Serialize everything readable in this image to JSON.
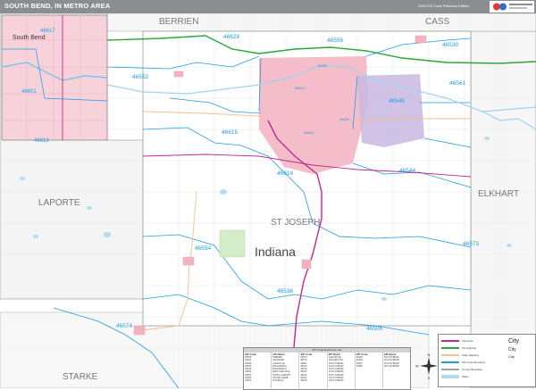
{
  "header": {
    "title": "SOUTH BEND, IN METRO AREA",
    "subtitle": "2020 ZIP Code Premium Edition"
  },
  "colors": {
    "water": "#b3dcf0",
    "zip_line": "#1e9be6",
    "highway": "#2aa63a",
    "interstate": "#c02a8a",
    "city_pink": "#f3b2c0",
    "city_purple": "#c9b8e2",
    "county_line": "#a0a0a0",
    "road": "#f2c28a"
  },
  "counties": {
    "berrien": "BERRIEN",
    "cass": "CASS",
    "laporte": "LAPORTE",
    "st_joseph": "ST JOSEPH",
    "elkhart": "ELKHART",
    "starke": "STARKE"
  },
  "state_label": "Indiana",
  "inset": {
    "city_label": "South Bend",
    "zips": [
      "46617",
      "46601",
      "46613"
    ]
  },
  "zips": {
    "z46552": "46552",
    "z46556": "46556",
    "z46530": "46530",
    "z46561": "46561",
    "z46545": "46545",
    "z46615": "46615",
    "z46614": "46614",
    "z46544": "46544",
    "z46554": "46554",
    "z46573": "46573",
    "z46536": "46536",
    "z46574": "46574",
    "z46506": "46506",
    "z46628": "46628",
    "z46616": "46616",
    "z46632": "46632",
    "z46680": "46680",
    "z46603": "46603"
  },
  "table": {
    "header": "ZIP Code Reference List",
    "columns": [
      {
        "h": "ZIP Code",
        "rows": [
          "46506",
          "46530",
          "46536",
          "46544",
          "46545",
          "46552",
          "46554",
          "46556",
          "46561"
        ]
      },
      {
        "h": "ZIP Name",
        "rows": [
          "BREMEN",
          "GRANGER",
          "LAKEVILLE",
          "MISHAWAKA",
          "MISHAWAKA",
          "NEW CARLISLE",
          "NORTH LIBERTY",
          "NOTRE DAME",
          "OSCEOLA"
        ]
      },
      {
        "h": "ZIP Code",
        "rows": [
          "46573",
          "46574",
          "46601",
          "46613",
          "46614",
          "46615",
          "46616",
          "46617",
          "46619"
        ]
      },
      {
        "h": "ZIP Name",
        "rows": [
          "WAKARUSA",
          "WALKERTON",
          "SOUTH BEND",
          "SOUTH BEND",
          "SOUTH BEND",
          "SOUTH BEND",
          "SOUTH BEND",
          "SOUTH BEND",
          "SOUTH BEND"
        ]
      },
      {
        "h": "ZIP Code",
        "rows": [
          "46628",
          "46635",
          "46637",
          "46680",
          "",
          "",
          "",
          "",
          ""
        ]
      },
      {
        "h": "ZIP Name",
        "rows": [
          "SOUTH BEND",
          "SOUTH BEND",
          "SOUTH BEND",
          "SOUTH BEND",
          "",
          "",
          "",
          "",
          ""
        ]
      }
    ]
  },
  "legend": {
    "items": [
      "Interstate",
      "US Highway",
      "State Highway",
      "ZIP Code Boundary",
      "County Boundary",
      "Water"
    ],
    "city_label": "City",
    "city_sub": "City",
    "city_sub2": "City"
  },
  "compass": {
    "n": "N",
    "s": "S",
    "e": "E",
    "w": "W"
  }
}
